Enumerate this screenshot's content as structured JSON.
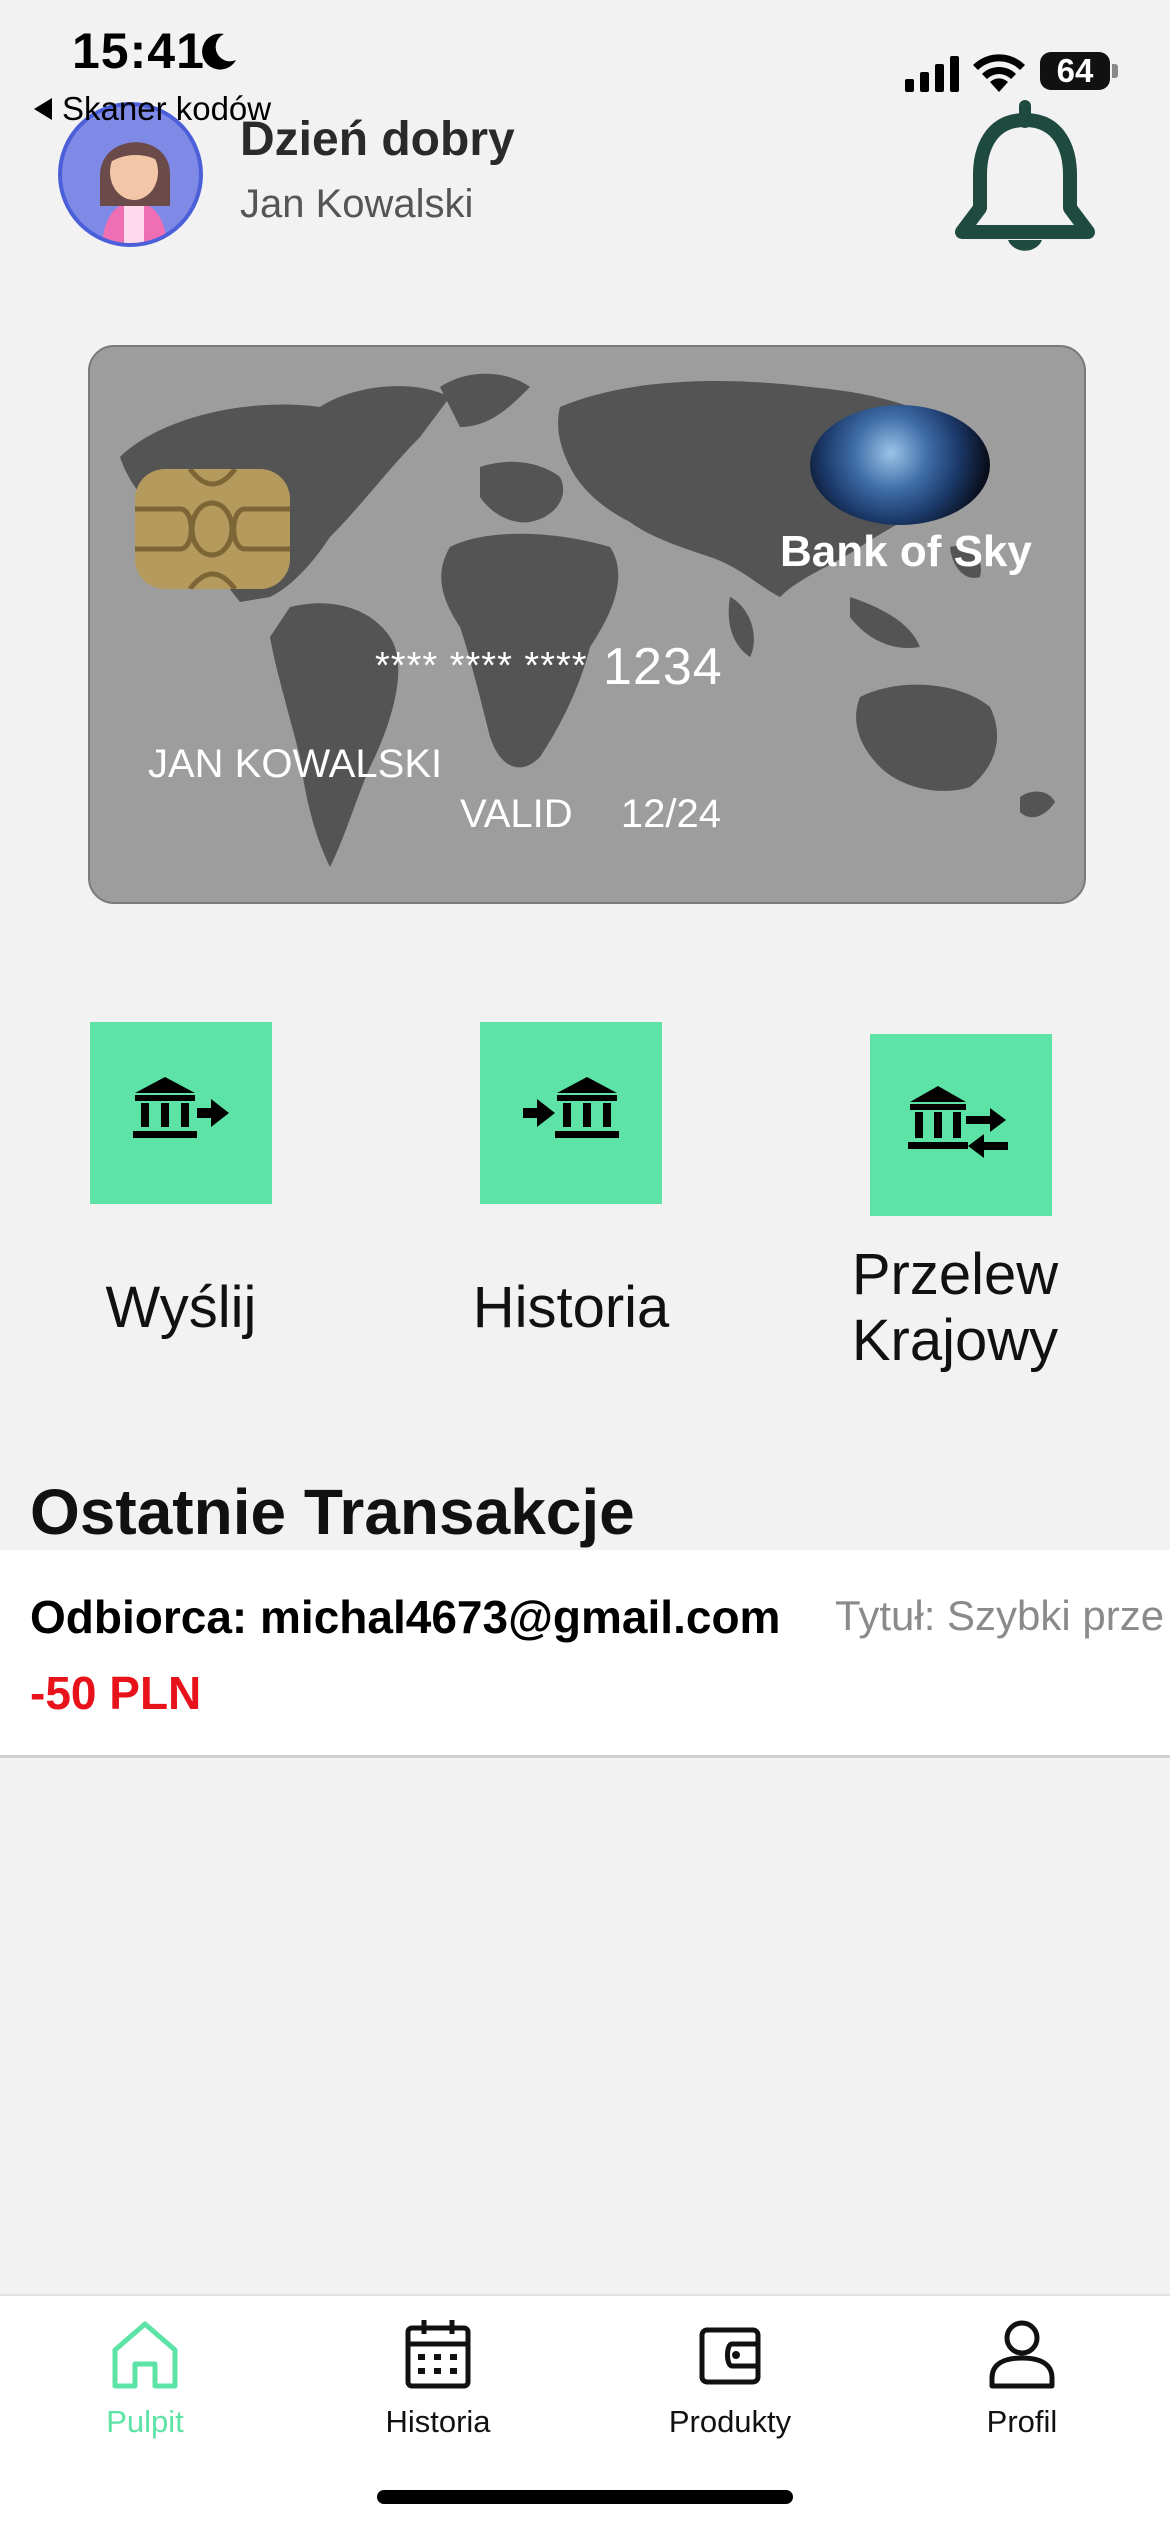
{
  "status_bar": {
    "time": "15:41",
    "back_label": "Skaner kodów",
    "battery": "64"
  },
  "header": {
    "greeting": "Dzień dobry",
    "user_name": "Jan Kowalski"
  },
  "card": {
    "bank_name": "Bank of Sky",
    "number_masked": "**** **** ****",
    "number_last": "1234",
    "holder": "JAN KOWALSKI",
    "valid_label": "VALID",
    "valid_date": "12/24"
  },
  "actions": [
    {
      "label": "Wyślij",
      "icon": "bank-send-icon"
    },
    {
      "label": "Historia",
      "icon": "bank-receive-icon"
    },
    {
      "label": "Przelew\nKrajowy",
      "icon": "bank-transfer-icon"
    }
  ],
  "transactions": {
    "title": "Ostatnie Transakcje",
    "items": [
      {
        "recipient": "Odbiorca: michal4673@gmail.com",
        "title": "Tytuł: Szybki prze",
        "amount": "-50 PLN"
      }
    ]
  },
  "tabbar": {
    "tabs": [
      {
        "label": "Pulpit",
        "icon": "home-icon",
        "active": true
      },
      {
        "label": "Historia",
        "icon": "calendar-icon",
        "active": false
      },
      {
        "label": "Produkty",
        "icon": "wallet-icon",
        "active": false
      },
      {
        "label": "Profil",
        "icon": "person-icon",
        "active": false
      }
    ]
  },
  "colors": {
    "accent": "#5de3a5",
    "negative_amount": "#e8121a",
    "bell": "#1f4a40",
    "card_bg": "#9d9d9d",
    "map": "#545454"
  }
}
